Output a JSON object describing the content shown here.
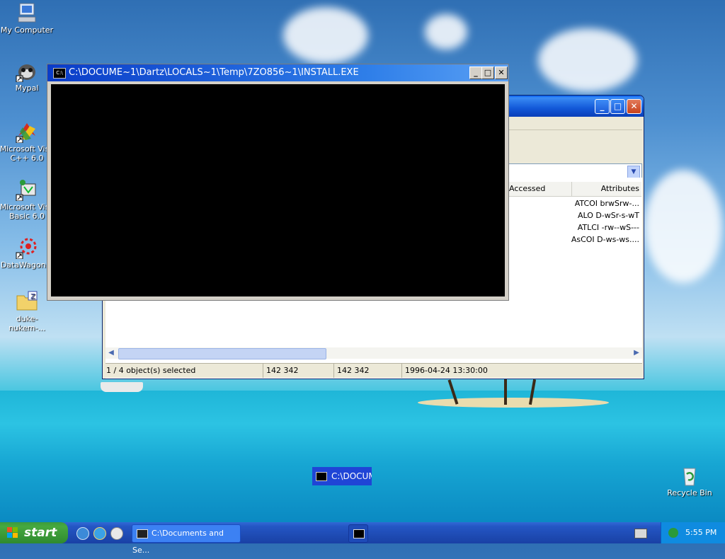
{
  "desktop": {
    "icons": [
      {
        "label": "My Computer"
      },
      {
        "label": "Mypal"
      },
      {
        "label": "Microsoft Visual C++ 6.0"
      },
      {
        "label": "Microsoft Visual Basic 6.0"
      },
      {
        "label": "DataWagon..."
      },
      {
        "label": "duke-nukem-..."
      },
      {
        "label": "Recycle Bin"
      }
    ],
    "icon_lines": [
      [
        "My Computer"
      ],
      [
        "Mypal"
      ],
      [
        "Microsoft Visu",
        "C++ 6.0"
      ],
      [
        "Microsoft Visu",
        "Basic 6.0"
      ],
      [
        "DataWagon..."
      ],
      [
        "duke-nukem-..."
      ],
      [
        "Recycle Bin"
      ]
    ]
  },
  "console_window": {
    "title": "C:\\DOCUME~1\\Dartz\\LOCALS~1\\Temp\\7ZO856~1\\INSTALL.EXE",
    "icon": "console-icon",
    "buttons": {
      "minimize": "_",
      "maximize": "□",
      "close": "✕"
    }
  },
  "explorer_window": {
    "columns": {
      "accessed": "Accessed",
      "attributes": "Attributes"
    },
    "rows": [
      {
        "attributes": "ATCOI brwSrw-..."
      },
      {
        "attributes": "ALO D-wSr-s-wT"
      },
      {
        "attributes": "ATLCI -rw--wS---"
      },
      {
        "attributes": "AsCOI D-ws-ws...."
      }
    ],
    "status": {
      "selection": "1 / 4 object(s) selected",
      "size": "142 342",
      "packed": "142 342",
      "date": "1996-04-24 13:30:00"
    }
  },
  "drag_ghost": {
    "text": "C:\\DOCUME"
  },
  "taskbar": {
    "start_label": "start",
    "tasks": [
      {
        "label": "C:\\Documents and Se..."
      },
      {
        "label": ""
      }
    ],
    "clock": "5:55 PM"
  },
  "colors": {
    "taskbar_blue": "#2456c4",
    "start_green": "#3c9b3c",
    "title_blue": "#0a3cc8",
    "console_bg": "#000000"
  }
}
